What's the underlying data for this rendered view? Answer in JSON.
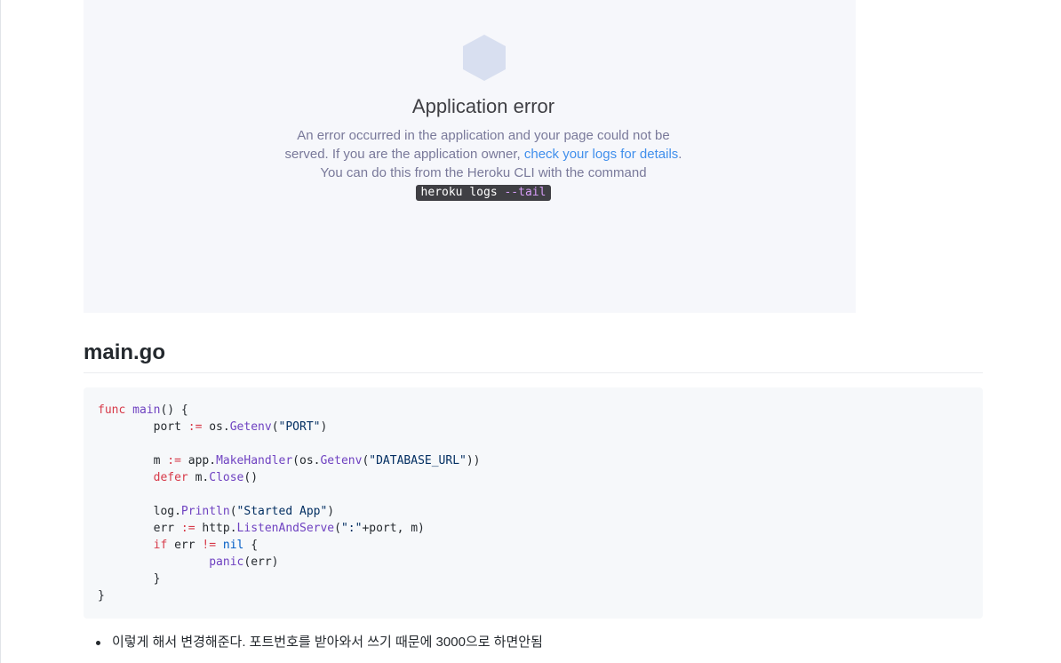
{
  "heroku": {
    "title": "Application error",
    "text_before_link": "An error occurred in the application and your page could not be served. If you are the application owner, ",
    "link_text": "check your logs for details",
    "text_after_link": ". You can do this from the Heroku CLI with the command",
    "command_base": "heroku logs ",
    "command_flag": "--tail",
    "colors": {
      "panel_bg": "#f6f7fb",
      "hexagon": "#d8dff0",
      "link": "#408fec",
      "command_bg": "#3f3f44"
    },
    "icon": "hexagon-icon"
  },
  "section": {
    "heading": "main.go"
  },
  "code": {
    "lines": [
      [
        {
          "t": "func",
          "c": "kw"
        },
        {
          "t": " "
        },
        {
          "t": "main",
          "c": "fn"
        },
        {
          "t": "() {"
        }
      ],
      [
        {
          "t": "        port "
        },
        {
          "t": ":=",
          "c": "op"
        },
        {
          "t": " os."
        },
        {
          "t": "Getenv",
          "c": "fn"
        },
        {
          "t": "("
        },
        {
          "t": "\"PORT\"",
          "c": "str"
        },
        {
          "t": ")"
        }
      ],
      [
        {
          "t": ""
        }
      ],
      [
        {
          "t": "        m "
        },
        {
          "t": ":=",
          "c": "op"
        },
        {
          "t": " app."
        },
        {
          "t": "MakeHandler",
          "c": "fn"
        },
        {
          "t": "(os."
        },
        {
          "t": "Getenv",
          "c": "fn"
        },
        {
          "t": "("
        },
        {
          "t": "\"DATABASE_URL\"",
          "c": "str"
        },
        {
          "t": "))"
        }
      ],
      [
        {
          "t": "        "
        },
        {
          "t": "defer",
          "c": "kw"
        },
        {
          "t": " m."
        },
        {
          "t": "Close",
          "c": "fn"
        },
        {
          "t": "()"
        }
      ],
      [
        {
          "t": ""
        }
      ],
      [
        {
          "t": "        log."
        },
        {
          "t": "Println",
          "c": "fn"
        },
        {
          "t": "("
        },
        {
          "t": "\"Started App\"",
          "c": "str"
        },
        {
          "t": ")"
        }
      ],
      [
        {
          "t": "        err "
        },
        {
          "t": ":=",
          "c": "op"
        },
        {
          "t": " http."
        },
        {
          "t": "ListenAndServe",
          "c": "fn"
        },
        {
          "t": "("
        },
        {
          "t": "\":\"",
          "c": "str"
        },
        {
          "t": "+port, m)"
        }
      ],
      [
        {
          "t": "        "
        },
        {
          "t": "if",
          "c": "kw"
        },
        {
          "t": " err "
        },
        {
          "t": "!=",
          "c": "op"
        },
        {
          "t": " "
        },
        {
          "t": "nil",
          "c": "nil"
        },
        {
          "t": " {"
        }
      ],
      [
        {
          "t": "                "
        },
        {
          "t": "panic",
          "c": "fn"
        },
        {
          "t": "(err)"
        }
      ],
      [
        {
          "t": "        }"
        }
      ],
      [
        {
          "t": "}"
        }
      ]
    ]
  },
  "list": {
    "items": [
      "이렇게 해서 변경해준다. 포트번호를 받아와서 쓰기 때문에 3000으로 하면안됨"
    ]
  }
}
